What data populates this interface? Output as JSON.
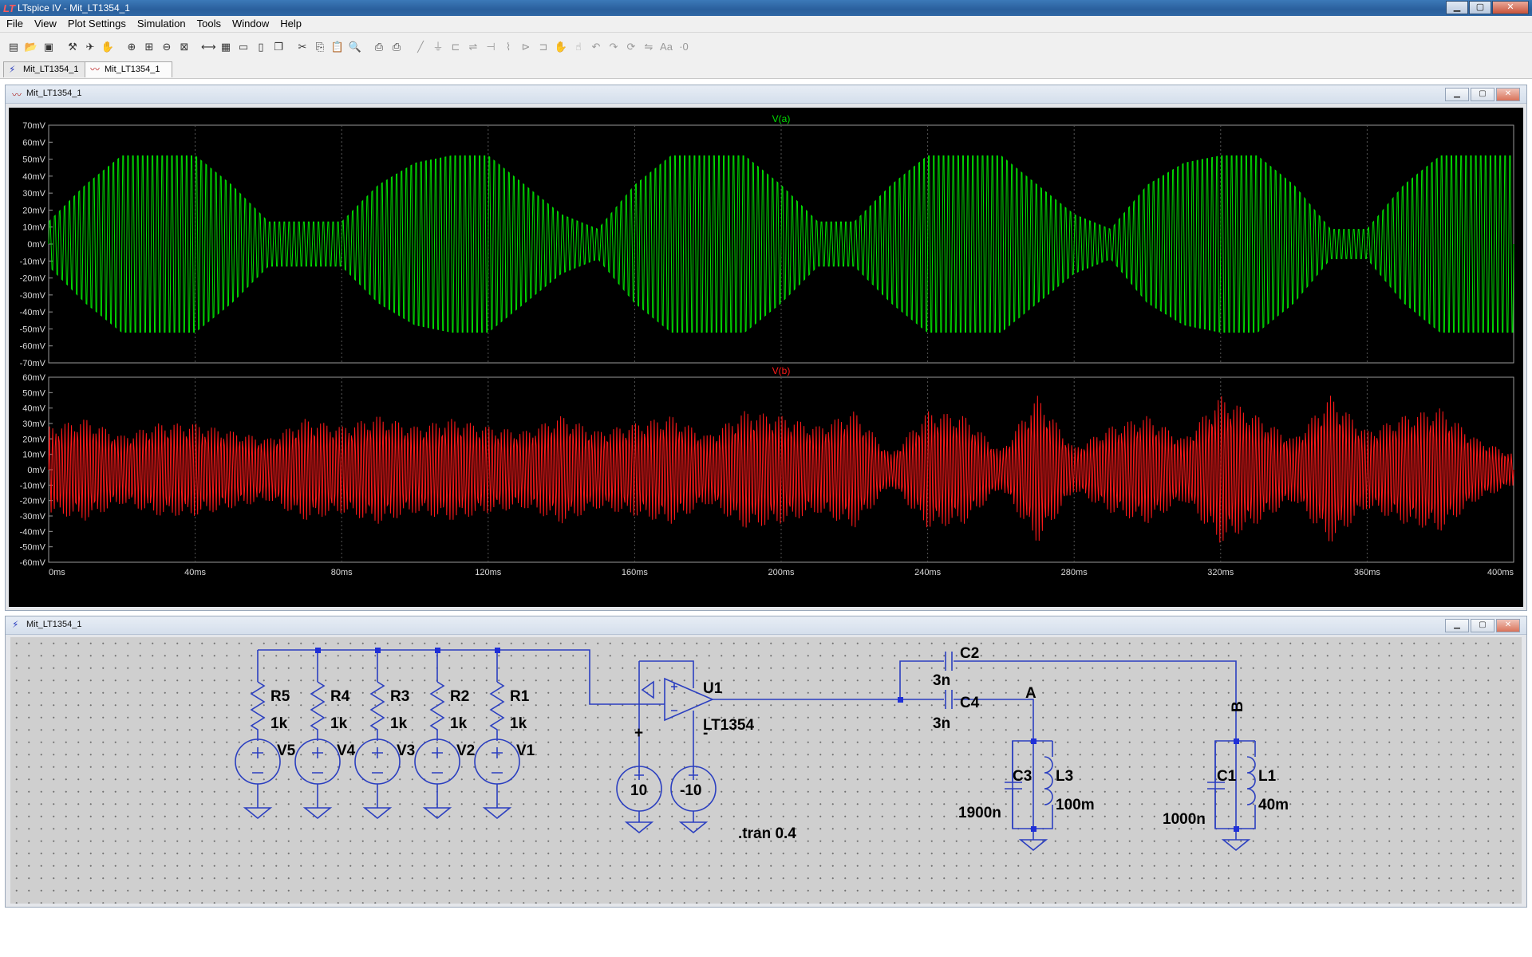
{
  "window": {
    "title": "LTspice IV - Mit_LT1354_1",
    "min_label": "▁",
    "max_label": "▢",
    "close_label": "✕"
  },
  "menu": [
    "File",
    "View",
    "Plot Settings",
    "Simulation",
    "Tools",
    "Window",
    "Help"
  ],
  "toolbar_icons": [
    "new-schematic-icon",
    "open-icon",
    "save-icon",
    "control-panel-icon",
    "run-icon",
    "pan-icon",
    "zoom-in-icon",
    "zoom-area-icon",
    "zoom-out-icon",
    "zoom-fit-icon",
    "autorange-icon",
    "toggle-grid-icon",
    "tile-horizontal-icon",
    "tile-vertical-icon",
    "cascade-icon",
    "cut-icon",
    "copy-icon",
    "paste-icon",
    "find-icon",
    "print-preview-icon",
    "print-icon",
    "draw-wire-icon",
    "ground-icon",
    "label-net-icon",
    "resistor-icon",
    "capacitor-icon",
    "inductor-icon",
    "diode-icon",
    "component-icon",
    "move-icon",
    "drag-icon",
    "undo-icon",
    "redo-icon",
    "rotate-icon",
    "mirror-icon",
    "text-icon",
    "spice-directive-icon"
  ],
  "tabs": [
    {
      "label": "Mit_LT1354_1",
      "icon": "schematic-icon"
    },
    {
      "label": "Mit_LT1354_1",
      "icon": "waveform-icon"
    }
  ],
  "plot_window": {
    "title": "Mit_LT1354_1",
    "panes": [
      {
        "trace": "V(a)",
        "color": "#00e000",
        "y_ticks": [
          "70mV",
          "60mV",
          "50mV",
          "40mV",
          "30mV",
          "20mV",
          "10mV",
          "0mV",
          "-10mV",
          "-20mV",
          "-30mV",
          "-40mV",
          "-50mV",
          "-60mV",
          "-70mV"
        ]
      },
      {
        "trace": "V(b)",
        "color": "#ff1a1a",
        "y_ticks": [
          "60mV",
          "50mV",
          "40mV",
          "30mV",
          "20mV",
          "10mV",
          "0mV",
          "-10mV",
          "-20mV",
          "-30mV",
          "-40mV",
          "-50mV",
          "-60mV"
        ]
      }
    ],
    "x_ticks": [
      "0ms",
      "40ms",
      "80ms",
      "120ms",
      "160ms",
      "200ms",
      "240ms",
      "280ms",
      "320ms",
      "360ms",
      "400ms"
    ]
  },
  "chart_data": [
    {
      "type": "line",
      "title": "V(a)",
      "xlim": [
        0,
        400
      ],
      "ylim": [
        -70,
        70
      ],
      "x_unit": "ms",
      "y_unit": "mV",
      "series": [
        {
          "name": "V(a)",
          "color": "#00e000",
          "envelope_x": [
            0,
            10,
            20,
            30,
            40,
            50,
            60,
            70,
            80,
            90,
            100,
            110,
            120,
            130,
            140,
            150,
            160,
            170,
            180,
            190,
            200,
            210,
            220,
            230,
            240,
            250,
            260,
            270,
            280,
            290,
            300,
            310,
            320,
            330,
            340,
            350,
            360,
            370,
            380,
            390,
            400
          ],
          "envelope_amplitude": [
            15,
            40,
            60,
            60,
            60,
            40,
            15,
            15,
            15,
            40,
            55,
            60,
            60,
            40,
            20,
            10,
            40,
            60,
            60,
            60,
            40,
            15,
            15,
            40,
            60,
            60,
            60,
            40,
            20,
            10,
            40,
            55,
            60,
            60,
            40,
            10,
            10,
            40,
            60,
            60,
            60
          ]
        }
      ]
    },
    {
      "type": "line",
      "title": "V(b)",
      "xlim": [
        0,
        400
      ],
      "ylim": [
        -60,
        60
      ],
      "x_unit": "ms",
      "y_unit": "mV",
      "series": [
        {
          "name": "V(b)",
          "color": "#ff1a1a",
          "envelope_x": [
            0,
            10,
            20,
            30,
            40,
            50,
            60,
            70,
            80,
            90,
            100,
            110,
            120,
            130,
            140,
            150,
            160,
            170,
            180,
            190,
            200,
            210,
            220,
            230,
            240,
            250,
            260,
            270,
            280,
            290,
            300,
            310,
            320,
            330,
            340,
            350,
            360,
            370,
            380,
            390,
            400
          ],
          "envelope_amplitude": [
            28,
            33,
            22,
            30,
            30,
            25,
            20,
            33,
            28,
            35,
            28,
            33,
            28,
            25,
            35,
            25,
            30,
            35,
            22,
            38,
            35,
            28,
            38,
            10,
            38,
            35,
            12,
            48,
            14,
            28,
            35,
            20,
            48,
            35,
            20,
            48,
            25,
            35,
            40,
            20,
            10
          ]
        }
      ]
    }
  ],
  "schematic_window": {
    "title": "Mit_LT1354_1",
    "resistors": [
      {
        "ref": "R5",
        "value": "1k"
      },
      {
        "ref": "R4",
        "value": "1k"
      },
      {
        "ref": "R3",
        "value": "1k"
      },
      {
        "ref": "R2",
        "value": "1k"
      },
      {
        "ref": "R1",
        "value": "1k"
      }
    ],
    "sources": [
      "V5",
      "V4",
      "V3",
      "V2",
      "V1"
    ],
    "opamp": {
      "ref": "U1",
      "model": "LT1354",
      "plus": "+",
      "minus": "-"
    },
    "supplies": [
      {
        "value": "10"
      },
      {
        "value": "-10"
      }
    ],
    "caps": [
      {
        "ref": "C2",
        "value": "3n"
      },
      {
        "ref": "C4",
        "value": "3n"
      },
      {
        "ref": "C3",
        "value": "1900n"
      },
      {
        "ref": "C1",
        "value": "1000n"
      }
    ],
    "inductors": [
      {
        "ref": "L3",
        "value": "100m"
      },
      {
        "ref": "L1",
        "value": "40m"
      }
    ],
    "nets": {
      "a": "A",
      "b": "B"
    },
    "directive": ".tran 0.4"
  },
  "colors": {
    "wire": "#2b3fc0",
    "component": "#2b3fc0",
    "junction": "#1f2fd8",
    "text": "#000000",
    "grid_bg": "#cfcfcf",
    "plot_bg": "#000000",
    "gridline": "#555555"
  }
}
